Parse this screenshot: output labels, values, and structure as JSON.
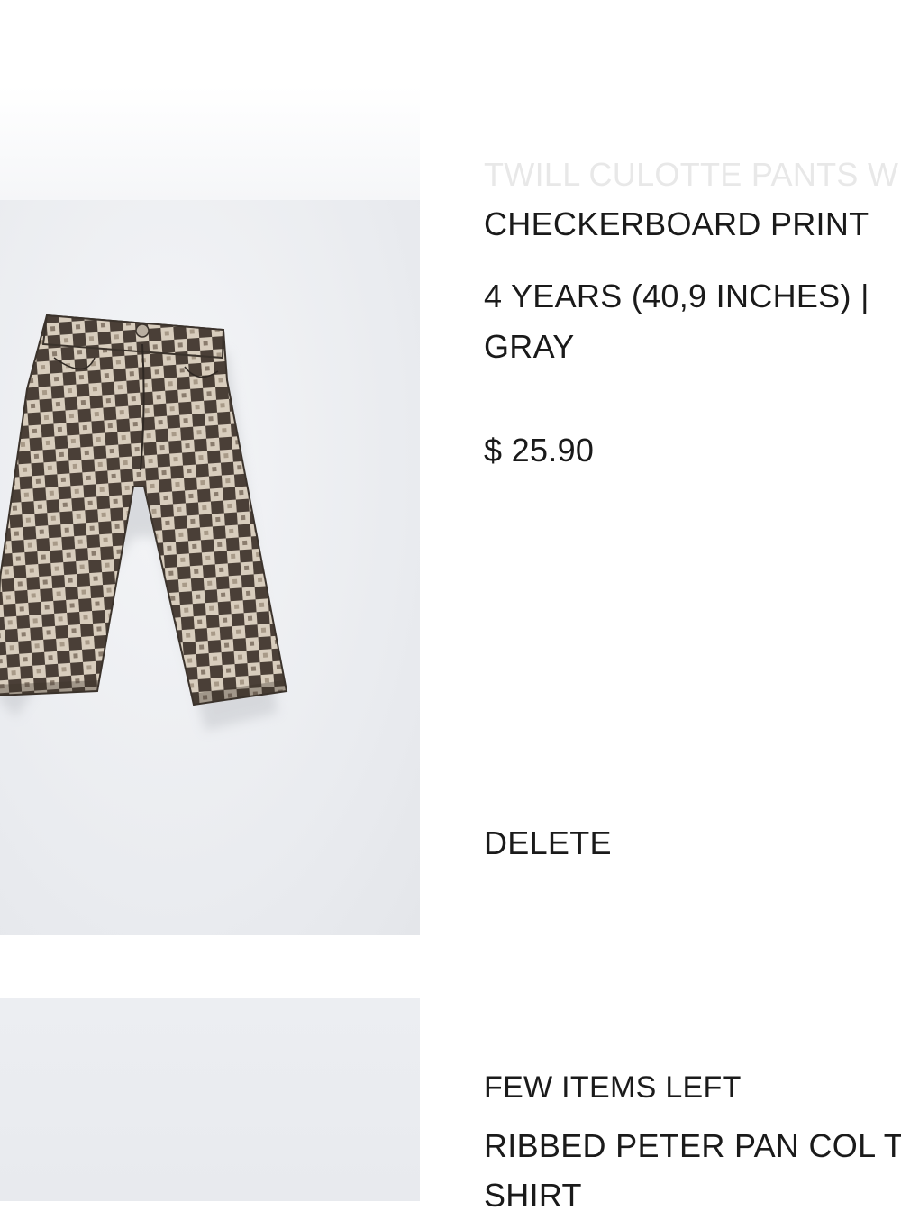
{
  "cart_items": [
    {
      "faded_title": "TWILL CULOTTE PANTS W",
      "title_line": "CHECKERBOARD PRINT",
      "size_color": "4 YEARS (40,9 INCHES) | GRAY",
      "price": "$ 25.90",
      "delete_label": "DELETE",
      "image_alt": "checkerboard-culotte-pants"
    },
    {
      "stock_status": "FEW ITEMS LEFT",
      "title": "RIBBED PETER PAN COL T-SHIRT"
    }
  ],
  "colors": {
    "checker_dark": "#4a3f37",
    "checker_light": "#d8cdbd",
    "image_bg": "#eceef2"
  }
}
